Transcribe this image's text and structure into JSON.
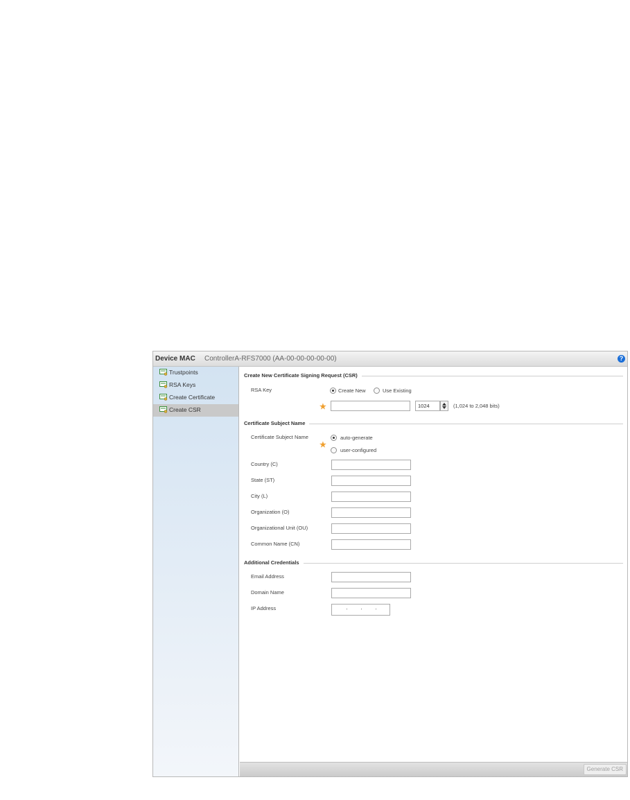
{
  "header": {
    "title": "Device MAC",
    "device": "ControllerA-RFS7000 (AA-00-00-00-00-00)",
    "help_glyph": "?"
  },
  "sidebar": {
    "items": [
      {
        "label": "Trustpoints",
        "icon": "certificate-icon"
      },
      {
        "label": "RSA Keys",
        "icon": "certificate-icon"
      },
      {
        "label": "Create Certificate",
        "icon": "certificate-icon"
      },
      {
        "label": "Create CSR",
        "icon": "certificate-icon",
        "active": true
      }
    ]
  },
  "csr": {
    "section_title": "Create New Certificate Signing Request (CSR)",
    "rsa_key_label": "RSA Key",
    "option_create_new": "Create New",
    "option_use_existing": "Use Existing",
    "selected": "Create New",
    "key_name_value": "",
    "key_size_value": "1024",
    "key_size_range": "(1,024 to 2,048 bits)"
  },
  "subject": {
    "section_title": "Certificate Subject Name",
    "mode_label": "Certificate Subject Name",
    "option_auto": "auto-generate",
    "option_user": "user-configured",
    "selected": "auto-generate",
    "fields": [
      {
        "label": "Country (C)",
        "value": ""
      },
      {
        "label": "State (ST)",
        "value": ""
      },
      {
        "label": "City (L)",
        "value": ""
      },
      {
        "label": "Organization (O)",
        "value": ""
      },
      {
        "label": "Organizational Unit (OU)",
        "value": ""
      },
      {
        "label": "Common Name (CN)",
        "value": ""
      }
    ]
  },
  "additional": {
    "section_title": "Additional Credentials",
    "email_label": "Email Address",
    "email_value": "",
    "domain_label": "Domain Name",
    "domain_value": "",
    "ip_label": "IP Address",
    "ip_value": ""
  },
  "footer": {
    "generate_label": "Generate CSR"
  },
  "colors": {
    "accent": "#1a6ed8",
    "required": "#f0a030",
    "sidebar_top": "#d3e3f2",
    "active_item": "#c9c9c9"
  }
}
